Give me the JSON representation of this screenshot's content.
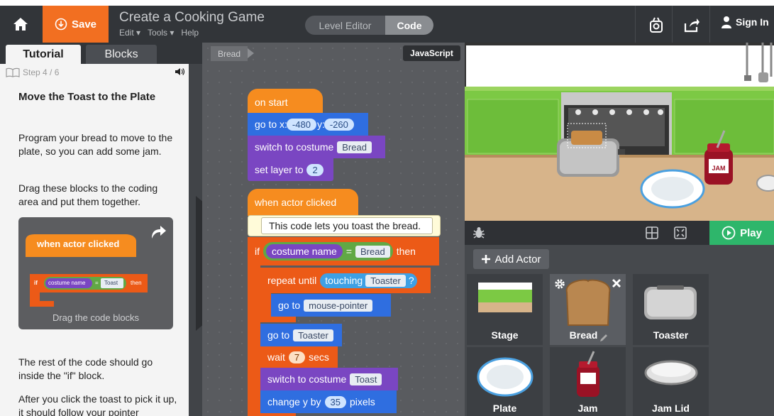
{
  "header": {
    "save_label": "Save",
    "title": "Create a Cooking Game",
    "menus": [
      "Edit ▾",
      "Tools ▾",
      "Help"
    ],
    "mode_tabs": [
      "Level Editor",
      "Code"
    ],
    "sign_in": "Sign In"
  },
  "left_panel": {
    "tabs": [
      "Tutorial",
      "Blocks"
    ],
    "step": "Step 4 / 6",
    "title": "Move the Toast to the Plate",
    "para1": "Program your bread to move to the plate, so you can add some jam.",
    "para2": "Drag these blocks to the coding area and put them together.",
    "card": {
      "hat": "when actor clicked",
      "if": "if",
      "cond_left": "costume name",
      "eq": "=",
      "cond_right": "Toast",
      "then": "then",
      "caption": "Drag the code blocks"
    },
    "para3": "The rest of the code should go inside the \"if\" block.",
    "para4": "After you click the toast to pick it up, it should follow your pointer"
  },
  "code": {
    "breadcrumb": "Bread",
    "lang_button": "JavaScript",
    "on_start": "on start",
    "goto_xy": {
      "label": "go to x:",
      "x": "-480",
      "ylabel": "y:",
      "y": "-260"
    },
    "switch_costume_1": {
      "label": "switch to costume",
      "value": "Bread"
    },
    "set_layer": {
      "label": "set layer to",
      "value": "2"
    },
    "when_clicked": "when actor clicked",
    "comment": "This code lets you toast the bread.",
    "if_block": {
      "if": "if",
      "left": "costume name",
      "eq": "=",
      "right": "Bread",
      "then": "then"
    },
    "repeat": {
      "label": "repeat until",
      "touching": "touching",
      "target": "Toaster",
      "q": "?"
    },
    "goto_pointer": {
      "label": "go to",
      "value": "mouse-pointer"
    },
    "goto_toaster": {
      "label": "go to",
      "value": "Toaster"
    },
    "wait": {
      "label": "wait",
      "value": "7",
      "unit": "secs"
    },
    "switch_costume_2": {
      "label": "switch to costume",
      "value": "Toast"
    },
    "change_y": {
      "label": "change y by",
      "value": "35",
      "unit": "pixels"
    }
  },
  "stage": {
    "play_label": "Play",
    "jar_label": "JAM"
  },
  "actors": {
    "add_label": "Add Actor",
    "tiles": [
      "Stage",
      "Bread",
      "Toaster",
      "Plate",
      "Jam",
      "Jam Lid"
    ]
  },
  "colors": {
    "header_bg": "#323539",
    "save_orange": "#f26f21",
    "play_green": "#2eb66b",
    "event_orange": "#f68c1f",
    "motion_blue": "#2f6ee0",
    "looks_purple": "#7a46c2",
    "control_red": "#ec5a17"
  },
  "icons": [
    "home-icon",
    "save-circle-icon",
    "camera-icon",
    "share-icon",
    "user-icon",
    "book-icon",
    "speaker-icon",
    "replay-arrow-icon",
    "chevron-left-icon",
    "bug-icon",
    "grid-icon",
    "fullscreen-icon",
    "play-circle-icon",
    "plus-icon",
    "gear-icon",
    "close-icon",
    "pencil-icon"
  ]
}
